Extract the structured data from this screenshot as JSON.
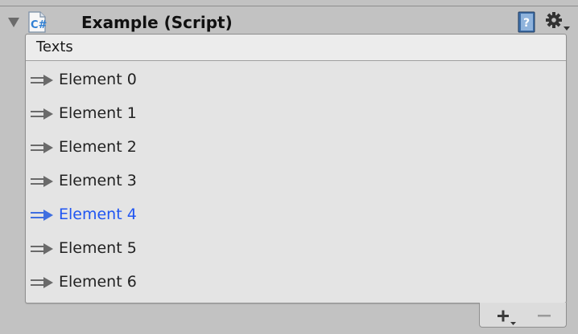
{
  "component": {
    "title": "Example (Script)",
    "expanded": true,
    "enabled": true,
    "icons": {
      "foldout": "foldout-arrow-icon",
      "script": "csharp-script-icon",
      "help": "help-book-icon",
      "settings": "gear-icon"
    }
  },
  "list": {
    "header": "Texts",
    "items": [
      {
        "label": "Element 0",
        "selected": false
      },
      {
        "label": "Element 1",
        "selected": false
      },
      {
        "label": "Element 2",
        "selected": false
      },
      {
        "label": "Element 3",
        "selected": false
      },
      {
        "label": "Element 4",
        "selected": true
      },
      {
        "label": "Element 5",
        "selected": false
      },
      {
        "label": "Element 6",
        "selected": false
      }
    ],
    "footer": {
      "add_icon": "plus-dropdown-icon",
      "remove_icon": "minus-icon"
    }
  },
  "colors": {
    "background": "#c2c2c2",
    "list_background": "#e4e4e4",
    "selected_text": "#1f55f2",
    "normal_text": "#222222"
  }
}
